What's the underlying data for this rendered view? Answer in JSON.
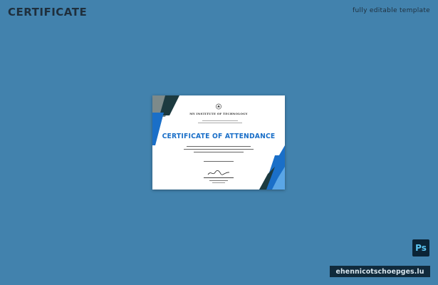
{
  "header": {
    "title": "CERTIFICATE",
    "tagline": "fully editable template"
  },
  "certificate": {
    "institute": "MY INSTITUTE OF TECHNOLOGY",
    "title": "CERTIFICATE OF ATTENDANCE",
    "accent_color": "#1a6fc8",
    "dark_color": "#1c3a40"
  },
  "badges": {
    "photoshop": "Ps",
    "watermark": "ehennicotschoepges.lu"
  },
  "icons": {
    "photoshop": "photoshop-icon",
    "logo": "institute-logo-icon",
    "signature": "signature-icon"
  }
}
